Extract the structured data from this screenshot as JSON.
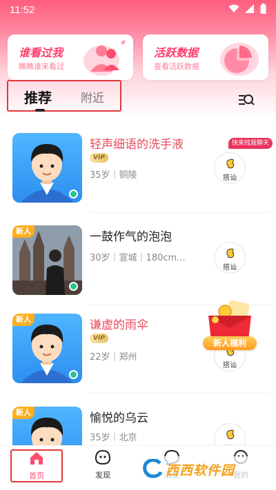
{
  "status_bar": {
    "time": "11:52"
  },
  "feature_cards": [
    {
      "title": "谁看过我",
      "subtitle": "瞧瞧谁来看过"
    },
    {
      "title": "活跃数据",
      "subtitle": "查看活跃数据"
    }
  ],
  "tabs": [
    {
      "label": "推荐",
      "active": true
    },
    {
      "label": "附近",
      "active": false
    }
  ],
  "hint_bubble": "快来找我聊天",
  "users": [
    {
      "name": "轻声细语的洗手液",
      "vip": "VIP",
      "info": "35岁｜铜陵",
      "greet": "搭讪",
      "new": "",
      "online": true
    },
    {
      "name": "一鼓作气的泡泡",
      "vip": "",
      "info": "30岁｜宣城｜180cm...",
      "greet": "搭讪",
      "new": "新人",
      "online": true
    },
    {
      "name": "谦虚的雨伞",
      "vip": "VIP",
      "info": "22岁｜郑州",
      "greet": "搭讪",
      "new": "新人",
      "online": true
    },
    {
      "name": "愉悦的乌云",
      "vip": "",
      "info": "35岁｜北京",
      "greet": "搭讪",
      "new": "新人",
      "online": false
    }
  ],
  "gift_label": "新人福利",
  "bottom_nav": [
    {
      "label": "首页"
    },
    {
      "label": "发现"
    },
    {
      "label": "消息"
    },
    {
      "label": "我的"
    }
  ],
  "watermark": "西西软件园",
  "colors": {
    "accent": "#ff4d6d",
    "vip_name": "#e84a5f",
    "online": "#28c48e"
  }
}
